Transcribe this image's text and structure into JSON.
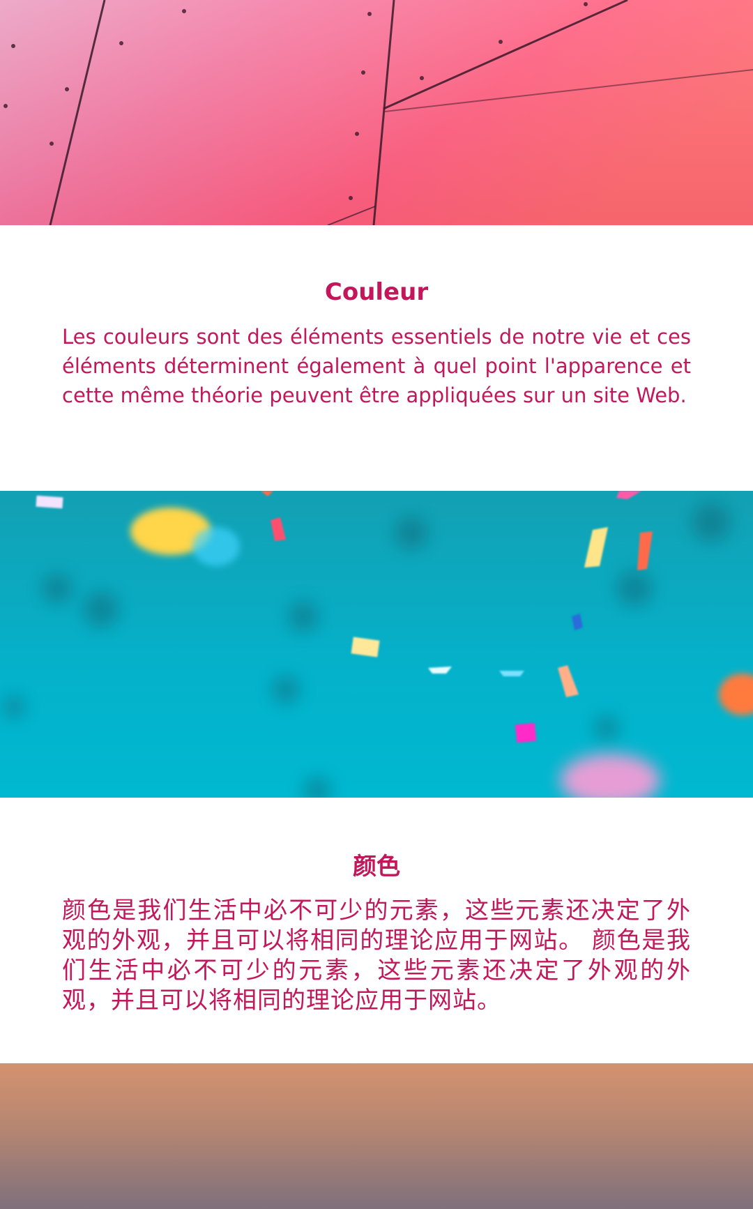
{
  "sections": [
    {
      "title": "Couleur",
      "body": "Les couleurs sont des éléments essentiels de notre vie et ces éléments déterminent également à quel point l'apparence et cette même théorie peuvent être appliquées sur un site Web."
    },
    {
      "title": "颜色",
      "body": "颜色是我们生活中必不可少的元素，这些元素还决定了外观的外观，并且可以将相同的理论应用于网站。 颜色是我们生活中必不可少的元素，这些元素还决定了外观的外观，并且可以将相同的理论应用于网站。"
    }
  ],
  "images": [
    {
      "name": "pink-wall-panels-image",
      "colors": [
        "#ea8fb7",
        "#ff5a78",
        "#ff6f6f"
      ]
    },
    {
      "name": "teal-confetti-image",
      "colors": [
        "#1aa2b5",
        "#00b5cf",
        "#ffd54a",
        "#ff5a7a"
      ]
    },
    {
      "name": "warm-gradient-image",
      "colors": [
        "#d3916f",
        "#a27f72",
        "#7e6f7a"
      ]
    }
  ],
  "theme": {
    "accent": "#c2185b",
    "background": "#ffffff"
  }
}
